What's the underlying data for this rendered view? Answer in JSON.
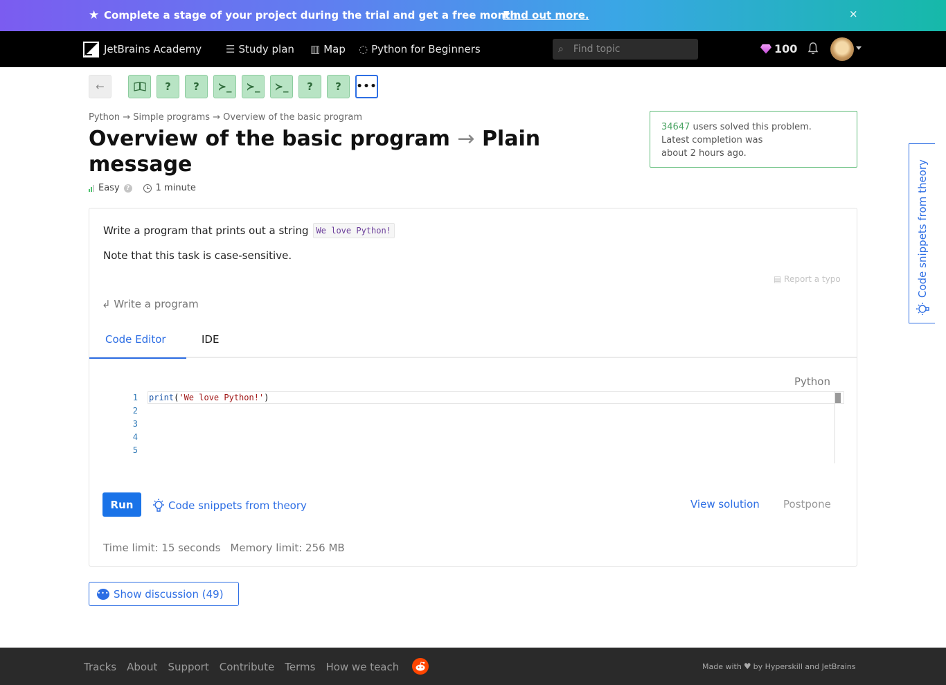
{
  "banner": {
    "text": "Complete a stage of your project during the trial and get a free month.",
    "link": "Find out more.",
    "close": "×"
  },
  "nav": {
    "brand": "JetBrains Academy",
    "study_plan": "Study plan",
    "map": "Map",
    "track": "Python for Beginners",
    "search_placeholder": "Find topic",
    "gems": "100"
  },
  "steps": [
    {
      "kind": "back",
      "glyph": "←"
    },
    {
      "kind": "theory",
      "glyph": "📖"
    },
    {
      "kind": "quiz",
      "glyph": "?"
    },
    {
      "kind": "quiz",
      "glyph": "?"
    },
    {
      "kind": "code",
      "glyph": "≻_"
    },
    {
      "kind": "code",
      "glyph": "≻_"
    },
    {
      "kind": "code",
      "glyph": "≻_"
    },
    {
      "kind": "quiz",
      "glyph": "?"
    },
    {
      "kind": "quiz",
      "glyph": "?"
    },
    {
      "kind": "more",
      "glyph": "•••"
    }
  ],
  "breadcrumb": "Python → Simple programs → Overview of the basic program",
  "title": {
    "topic": "Overview of the basic program",
    "arrow": "→",
    "task": "Plain message"
  },
  "meta": {
    "difficulty": "Easy",
    "help": "?",
    "duration": "1 minute"
  },
  "solved": {
    "count": "34647",
    "line1_rest": " users solved this problem.",
    "line2": "Latest completion was",
    "line3": "about 2 hours ago."
  },
  "task": {
    "text": "Write a program that prints out a string",
    "code_literal": "We love Python!",
    "note": "Note that this task is case-sensitive.",
    "report_typo": "Report a typo",
    "write_label": "Write a program"
  },
  "tabs": [
    "Code Editor",
    "IDE"
  ],
  "editor": {
    "language": "Python",
    "line_numbers": [
      "1",
      "2",
      "3",
      "4",
      "5"
    ],
    "code_fn": "print",
    "code_open": "(",
    "code_str": "'We love Python!'",
    "code_close": ")"
  },
  "actions": {
    "run": "Run",
    "snippets": "Code snippets from theory",
    "view_solution": "View solution",
    "postpone": "Postpone"
  },
  "limits": {
    "time": "Time limit: 15 seconds",
    "memory": "Memory limit: 256 MB"
  },
  "discussion": "Show discussion (49)",
  "side_tab": "Code snippets from theory",
  "footer": {
    "links": [
      "Tracks",
      "About",
      "Support",
      "Contribute",
      "Terms",
      "How we teach"
    ],
    "made_prefix": "Made with",
    "made_suffix": "by Hyperskill and JetBrains"
  },
  "colors": {
    "accent": "#2d6ee4",
    "success": "#5cba76",
    "done_step": "#b8e4c4"
  }
}
